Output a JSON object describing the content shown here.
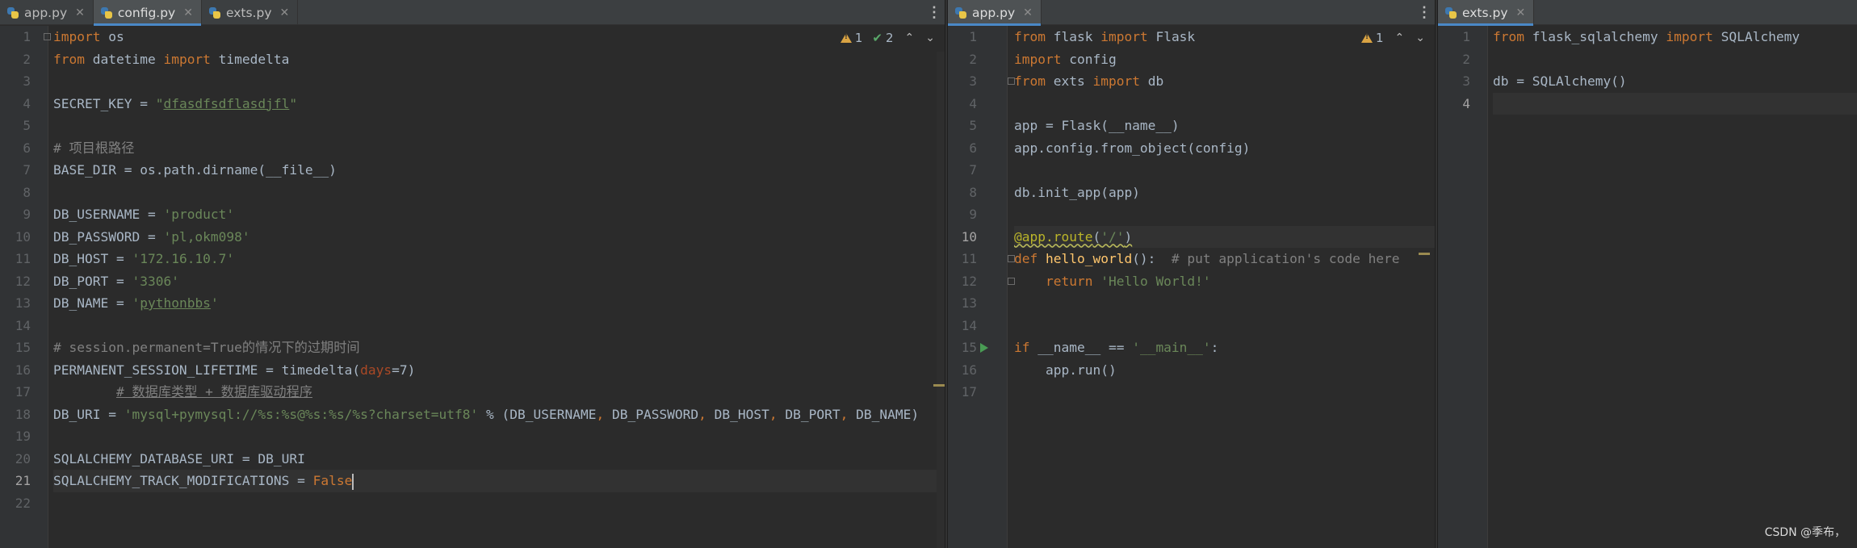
{
  "panes": [
    {
      "tabs": [
        {
          "label": "app.py",
          "active": false
        },
        {
          "label": "config.py",
          "active": true
        },
        {
          "label": "exts.py",
          "active": false
        }
      ],
      "inspection": {
        "warnings": "1",
        "weak_warnings": "2"
      },
      "current_line": 21,
      "lines": [
        [
          [
            "kw",
            "import"
          ],
          [
            "t",
            " os"
          ]
        ],
        [
          [
            "kw",
            "from"
          ],
          [
            "t",
            " datetime "
          ],
          [
            "kw",
            "import"
          ],
          [
            "t",
            " timedelta"
          ]
        ],
        [],
        [
          [
            "t",
            "SECRET_KEY = "
          ],
          [
            "str",
            "\""
          ],
          [
            "str-u",
            "dfasdfsdflasdjfl"
          ],
          [
            "str",
            "\""
          ]
        ],
        [],
        [
          [
            "cmt",
            "# 项目根路径"
          ]
        ],
        [
          [
            "t",
            "BASE_DIR = os.path.dirname(__file__)"
          ]
        ],
        [],
        [
          [
            "t",
            "DB_USERNAME = "
          ],
          [
            "str",
            "'product'"
          ]
        ],
        [
          [
            "t",
            "DB_PASSWORD = "
          ],
          [
            "str",
            "'pl,okm098'"
          ]
        ],
        [
          [
            "t",
            "DB_HOST = "
          ],
          [
            "str",
            "'172.16.10.7'"
          ]
        ],
        [
          [
            "t",
            "DB_PORT = "
          ],
          [
            "str",
            "'3306'"
          ]
        ],
        [
          [
            "t",
            "DB_NAME = "
          ],
          [
            "str",
            "'"
          ],
          [
            "str-u",
            "pythonbbs"
          ],
          [
            "str",
            "'"
          ]
        ],
        [],
        [
          [
            "cmt",
            "# session.permanent=True的情况下的过期时间"
          ]
        ],
        [
          [
            "t",
            "PERMANENT_SESSION_LIFETIME = timedelta("
          ],
          [
            "param",
            "days"
          ],
          [
            "t",
            "="
          ],
          [
            "t",
            "7"
          ],
          [
            "t",
            ")"
          ]
        ],
        [
          [
            "t",
            "        "
          ],
          [
            "cmt-u",
            "# 数据库类型 + 数据库驱动程序"
          ]
        ],
        [
          [
            "t",
            "DB_URI = "
          ],
          [
            "str",
            "'mysql+pymysql://%s:%s@%s:%s/%s?charset=utf8'"
          ],
          [
            "t",
            " % (DB_USERNAME"
          ],
          [
            "kw",
            ","
          ],
          [
            "t",
            " DB_PASSWORD"
          ],
          [
            "kw",
            ","
          ],
          [
            "t",
            " DB_HOST"
          ],
          [
            "kw",
            ","
          ],
          [
            "t",
            " DB_PORT"
          ],
          [
            "kw",
            ","
          ],
          [
            "t",
            " DB_NAME)"
          ]
        ],
        [],
        [
          [
            "t",
            "SQLALCHEMY_DATABASE_URI = DB_URI"
          ]
        ],
        [
          [
            "t",
            "SQLALCHEMY_TRACK_MODIFICATIONS = "
          ],
          [
            "kw",
            "False"
          ]
        ],
        []
      ]
    },
    {
      "tabs": [
        {
          "label": "app.py",
          "active": true
        }
      ],
      "inspection": {
        "warnings": "1"
      },
      "current_line": 10,
      "lines": [
        [
          [
            "kw",
            "from"
          ],
          [
            "t",
            " flask "
          ],
          [
            "kw",
            "import"
          ],
          [
            "t",
            " Flask"
          ]
        ],
        [
          [
            "kw",
            "import"
          ],
          [
            "t",
            " config"
          ]
        ],
        [
          [
            "kw",
            "from"
          ],
          [
            "t",
            " exts "
          ],
          [
            "kw",
            "import"
          ],
          [
            "t",
            " db"
          ]
        ],
        [],
        [
          [
            "t",
            "app = Flask(__name__)"
          ]
        ],
        [
          [
            "t",
            "app.config.from_object(config)"
          ]
        ],
        [],
        [
          [
            "t",
            "db.init_app(app)"
          ]
        ],
        [],
        [
          [
            "deco-w",
            "@app.route"
          ],
          [
            "t-w",
            "("
          ],
          [
            "str-w",
            "'/'"
          ],
          [
            "t-w",
            ")"
          ]
        ],
        [
          [
            "kw",
            "def "
          ],
          [
            "fn",
            "hello_world"
          ],
          [
            "t",
            "():  "
          ],
          [
            "cmt",
            "# put application's code here"
          ]
        ],
        [
          [
            "t",
            "    "
          ],
          [
            "kw",
            "return "
          ],
          [
            "str",
            "'Hello World!'"
          ]
        ],
        [],
        [],
        [
          [
            "kw",
            "if"
          ],
          [
            "t",
            " __name__ == "
          ],
          [
            "str",
            "'__main__'"
          ],
          [
            "t",
            ":"
          ]
        ],
        [
          [
            "t",
            "    app.run()"
          ]
        ],
        []
      ]
    },
    {
      "tabs": [
        {
          "label": "exts.py",
          "active": true
        }
      ],
      "current_line": 4,
      "lines": [
        [
          [
            "kw",
            "from"
          ],
          [
            "t",
            " flask_sqlalchemy "
          ],
          [
            "kw",
            "import"
          ],
          [
            "t",
            " SQLAlchemy"
          ]
        ],
        [],
        [
          [
            "t",
            "db = SQLAlchemy()"
          ]
        ],
        []
      ]
    }
  ],
  "watermark": "CSDN @季布，",
  "colors": {
    "background": "#2b2b2b",
    "gutter": "#313335",
    "keyword": "#cc7832",
    "string": "#6a8759",
    "comment": "#808080",
    "function": "#ffc66d",
    "parameter": "#aa4926",
    "decorator": "#bbb529",
    "accent": "#4a88c7"
  }
}
